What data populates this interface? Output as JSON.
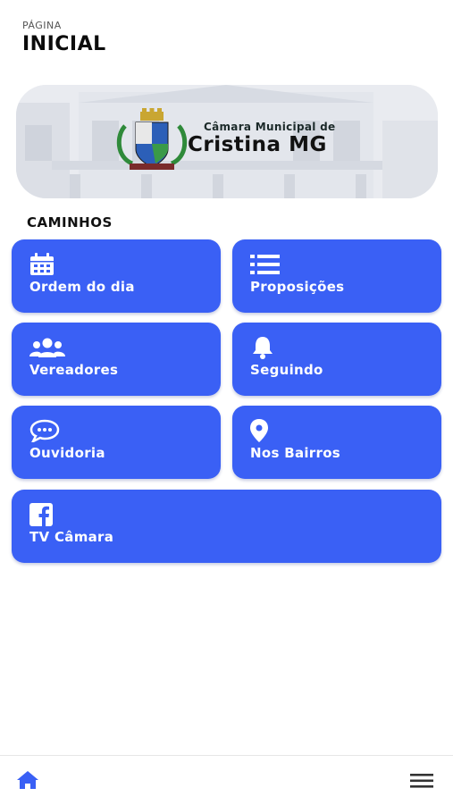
{
  "header": {
    "subtitle": "PÁGINA",
    "title": "INICIAL"
  },
  "banner": {
    "line1": "Câmara Municipal de",
    "line2": "Cristina MG"
  },
  "section_title": "CAMINHOS",
  "cards": [
    {
      "label": "Ordem do dia",
      "icon": "calendar-icon"
    },
    {
      "label": "Proposições",
      "icon": "list-icon"
    },
    {
      "label": "Vereadores",
      "icon": "users-icon"
    },
    {
      "label": "Seguindo",
      "icon": "bell-icon"
    },
    {
      "label": "Ouvidoria",
      "icon": "chat-icon"
    },
    {
      "label": "Nos Bairros",
      "icon": "map-pin-icon"
    },
    {
      "label": "TV Câmara",
      "icon": "facebook-icon"
    }
  ],
  "colors": {
    "accent": "#3a60f5",
    "nav": "#3a60f5"
  },
  "bottom_nav": {
    "left_icon": "home-icon",
    "right_icon": "menu-icon"
  }
}
